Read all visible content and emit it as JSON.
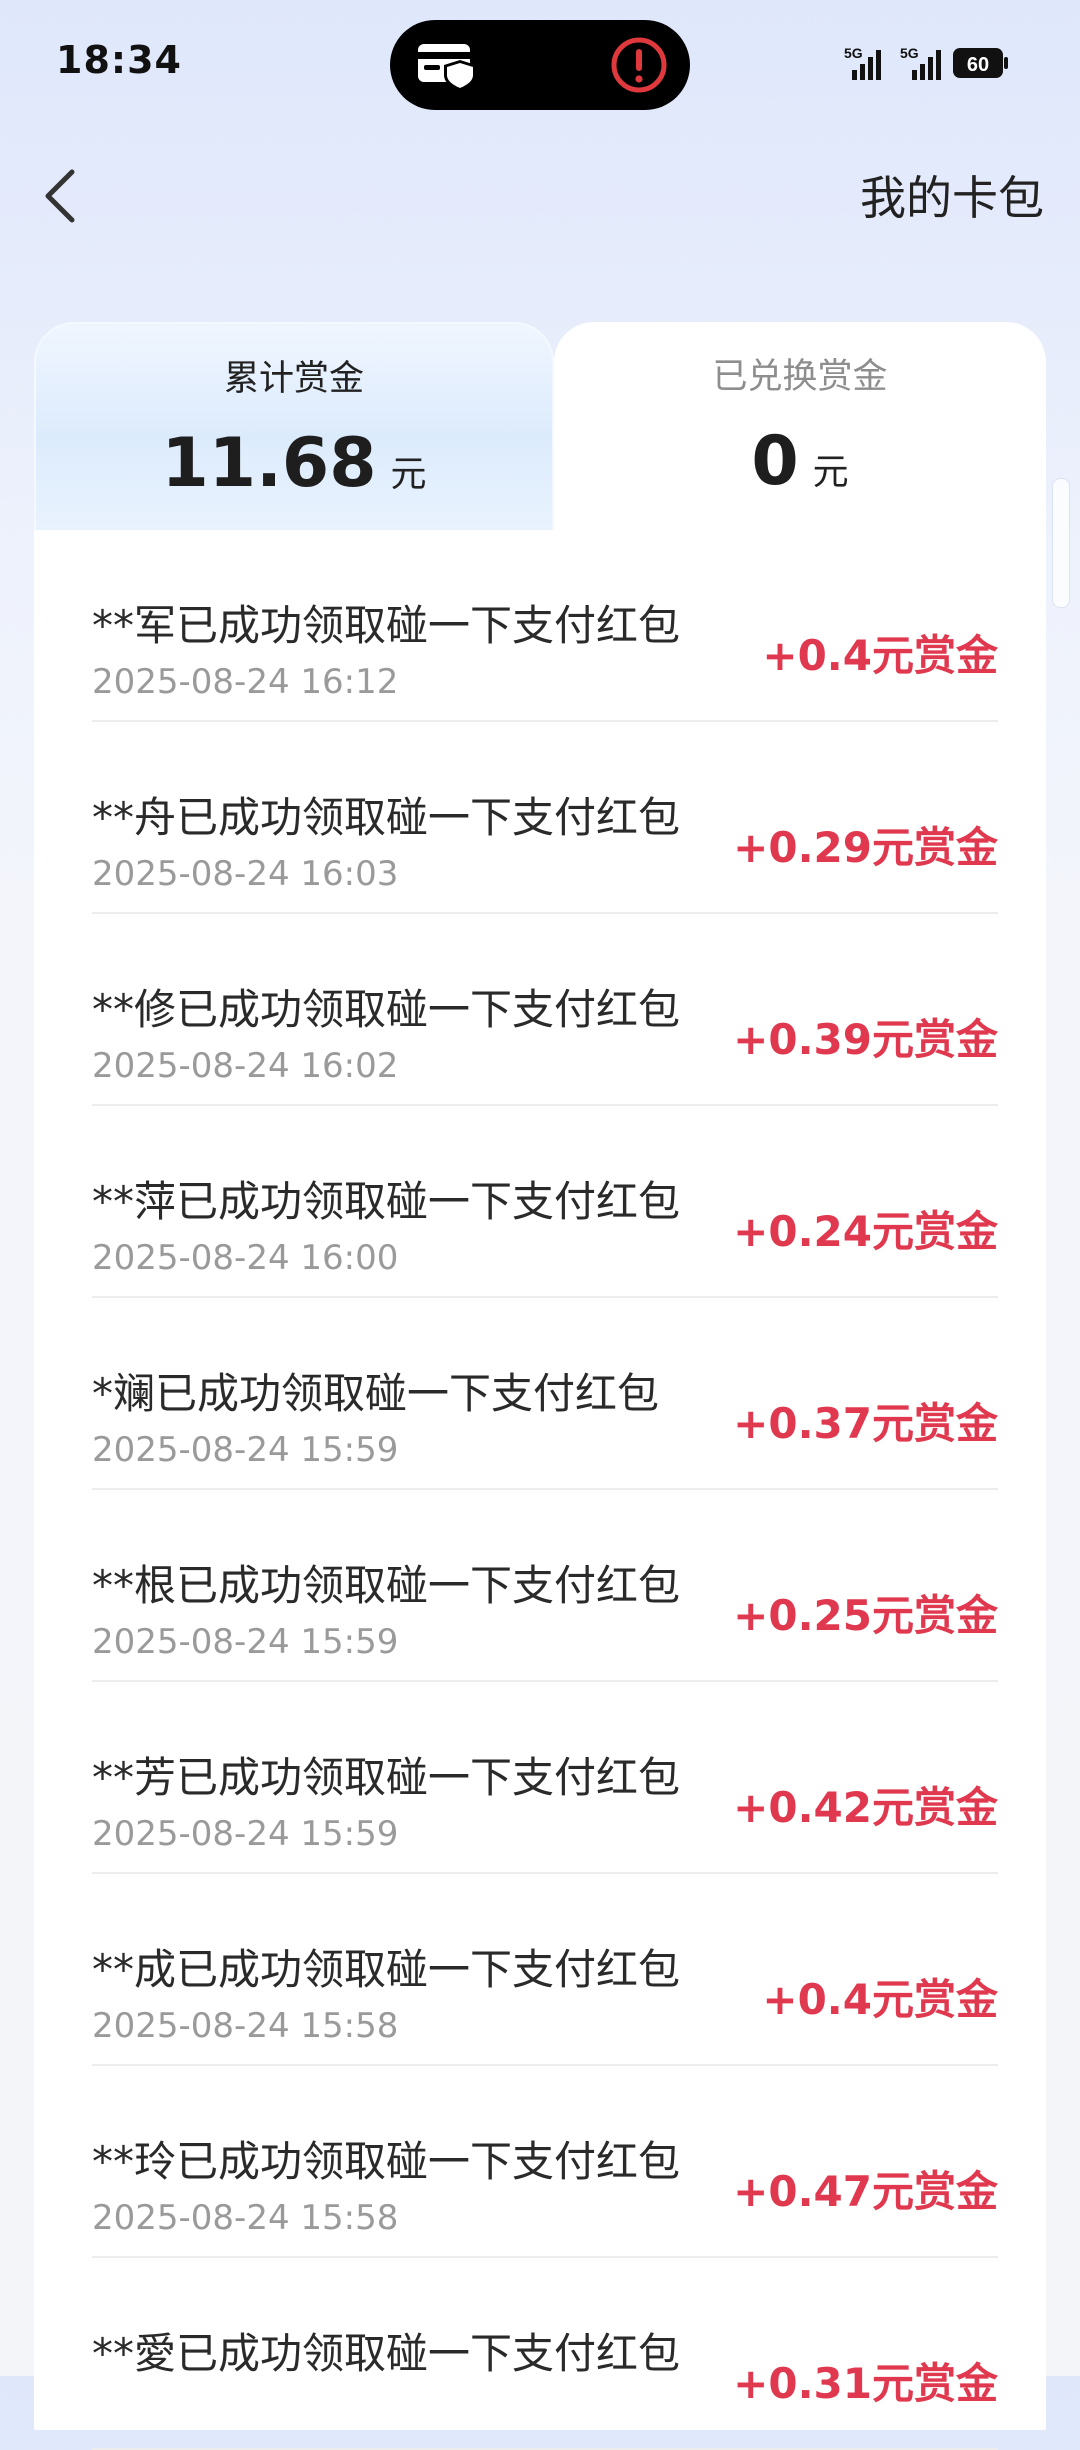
{
  "status_bar": {
    "time": "18:34",
    "signal_label": "5G",
    "battery": "60",
    "island_icons": [
      "card-shield-icon",
      "alert-icon"
    ]
  },
  "header": {
    "back_icon": "chevron-left-icon",
    "title": "我的卡包"
  },
  "tabs": [
    {
      "label": "累计赏金",
      "amount": "11.68",
      "unit": "元",
      "active": true
    },
    {
      "label": "已兑换赏金",
      "amount": "0",
      "unit": "元",
      "active": false
    }
  ],
  "rewards": [
    {
      "title": "**军已成功领取碰一下支付红包",
      "time": "2025-08-24 16:12",
      "amount": "+0.4元赏金"
    },
    {
      "title": "**舟已成功领取碰一下支付红包",
      "time": "2025-08-24 16:03",
      "amount": "+0.29元赏金"
    },
    {
      "title": "**修已成功领取碰一下支付红包",
      "time": "2025-08-24 16:02",
      "amount": "+0.39元赏金"
    },
    {
      "title": "**萍已成功领取碰一下支付红包",
      "time": "2025-08-24 16:00",
      "amount": "+0.24元赏金"
    },
    {
      "title": "*斓已成功领取碰一下支付红包",
      "time": "2025-08-24 15:59",
      "amount": "+0.37元赏金"
    },
    {
      "title": "**根已成功领取碰一下支付红包",
      "time": "2025-08-24 15:59",
      "amount": "+0.25元赏金"
    },
    {
      "title": "**芳已成功领取碰一下支付红包",
      "time": "2025-08-24 15:59",
      "amount": "+0.42元赏金"
    },
    {
      "title": "**成已成功领取碰一下支付红包",
      "time": "2025-08-24 15:58",
      "amount": "+0.4元赏金"
    },
    {
      "title": "**玲已成功领取碰一下支付红包",
      "time": "2025-08-24 15:58",
      "amount": "+0.47元赏金"
    },
    {
      "title": "**愛已成功领取碰一下支付红包",
      "time": "",
      "amount": "+0.31元赏金"
    }
  ],
  "colors": {
    "amount_red": "#e0394f",
    "secondary_gray": "#9a9a9a",
    "background_blue": "#dfe7fb"
  }
}
